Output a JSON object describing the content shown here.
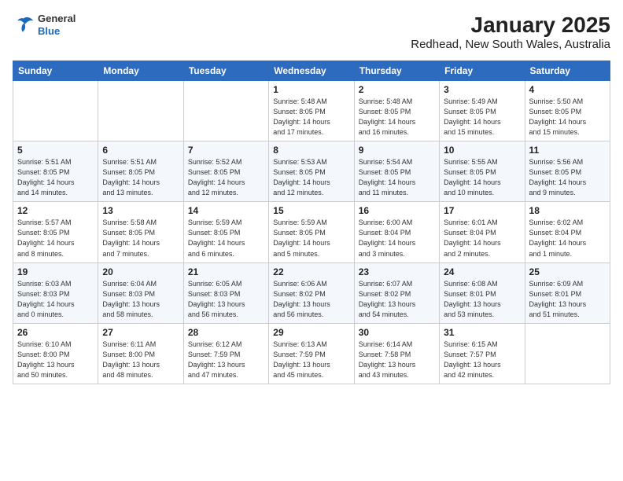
{
  "header": {
    "logo": {
      "general": "General",
      "blue": "Blue"
    },
    "title": "January 2025",
    "subtitle": "Redhead, New South Wales, Australia"
  },
  "calendar": {
    "days_of_week": [
      "Sunday",
      "Monday",
      "Tuesday",
      "Wednesday",
      "Thursday",
      "Friday",
      "Saturday"
    ],
    "weeks": [
      [
        {
          "day": "",
          "info": ""
        },
        {
          "day": "",
          "info": ""
        },
        {
          "day": "",
          "info": ""
        },
        {
          "day": "1",
          "info": "Sunrise: 5:48 AM\nSunset: 8:05 PM\nDaylight: 14 hours\nand 17 minutes."
        },
        {
          "day": "2",
          "info": "Sunrise: 5:48 AM\nSunset: 8:05 PM\nDaylight: 14 hours\nand 16 minutes."
        },
        {
          "day": "3",
          "info": "Sunrise: 5:49 AM\nSunset: 8:05 PM\nDaylight: 14 hours\nand 15 minutes."
        },
        {
          "day": "4",
          "info": "Sunrise: 5:50 AM\nSunset: 8:05 PM\nDaylight: 14 hours\nand 15 minutes."
        }
      ],
      [
        {
          "day": "5",
          "info": "Sunrise: 5:51 AM\nSunset: 8:05 PM\nDaylight: 14 hours\nand 14 minutes."
        },
        {
          "day": "6",
          "info": "Sunrise: 5:51 AM\nSunset: 8:05 PM\nDaylight: 14 hours\nand 13 minutes."
        },
        {
          "day": "7",
          "info": "Sunrise: 5:52 AM\nSunset: 8:05 PM\nDaylight: 14 hours\nand 12 minutes."
        },
        {
          "day": "8",
          "info": "Sunrise: 5:53 AM\nSunset: 8:05 PM\nDaylight: 14 hours\nand 12 minutes."
        },
        {
          "day": "9",
          "info": "Sunrise: 5:54 AM\nSunset: 8:05 PM\nDaylight: 14 hours\nand 11 minutes."
        },
        {
          "day": "10",
          "info": "Sunrise: 5:55 AM\nSunset: 8:05 PM\nDaylight: 14 hours\nand 10 minutes."
        },
        {
          "day": "11",
          "info": "Sunrise: 5:56 AM\nSunset: 8:05 PM\nDaylight: 14 hours\nand 9 minutes."
        }
      ],
      [
        {
          "day": "12",
          "info": "Sunrise: 5:57 AM\nSunset: 8:05 PM\nDaylight: 14 hours\nand 8 minutes."
        },
        {
          "day": "13",
          "info": "Sunrise: 5:58 AM\nSunset: 8:05 PM\nDaylight: 14 hours\nand 7 minutes."
        },
        {
          "day": "14",
          "info": "Sunrise: 5:59 AM\nSunset: 8:05 PM\nDaylight: 14 hours\nand 6 minutes."
        },
        {
          "day": "15",
          "info": "Sunrise: 5:59 AM\nSunset: 8:05 PM\nDaylight: 14 hours\nand 5 minutes."
        },
        {
          "day": "16",
          "info": "Sunrise: 6:00 AM\nSunset: 8:04 PM\nDaylight: 14 hours\nand 3 minutes."
        },
        {
          "day": "17",
          "info": "Sunrise: 6:01 AM\nSunset: 8:04 PM\nDaylight: 14 hours\nand 2 minutes."
        },
        {
          "day": "18",
          "info": "Sunrise: 6:02 AM\nSunset: 8:04 PM\nDaylight: 14 hours\nand 1 minute."
        }
      ],
      [
        {
          "day": "19",
          "info": "Sunrise: 6:03 AM\nSunset: 8:03 PM\nDaylight: 14 hours\nand 0 minutes."
        },
        {
          "day": "20",
          "info": "Sunrise: 6:04 AM\nSunset: 8:03 PM\nDaylight: 13 hours\nand 58 minutes."
        },
        {
          "day": "21",
          "info": "Sunrise: 6:05 AM\nSunset: 8:03 PM\nDaylight: 13 hours\nand 56 minutes."
        },
        {
          "day": "22",
          "info": "Sunrise: 6:06 AM\nSunset: 8:02 PM\nDaylight: 13 hours\nand 56 minutes."
        },
        {
          "day": "23",
          "info": "Sunrise: 6:07 AM\nSunset: 8:02 PM\nDaylight: 13 hours\nand 54 minutes."
        },
        {
          "day": "24",
          "info": "Sunrise: 6:08 AM\nSunset: 8:01 PM\nDaylight: 13 hours\nand 53 minutes."
        },
        {
          "day": "25",
          "info": "Sunrise: 6:09 AM\nSunset: 8:01 PM\nDaylight: 13 hours\nand 51 minutes."
        }
      ],
      [
        {
          "day": "26",
          "info": "Sunrise: 6:10 AM\nSunset: 8:00 PM\nDaylight: 13 hours\nand 50 minutes."
        },
        {
          "day": "27",
          "info": "Sunrise: 6:11 AM\nSunset: 8:00 PM\nDaylight: 13 hours\nand 48 minutes."
        },
        {
          "day": "28",
          "info": "Sunrise: 6:12 AM\nSunset: 7:59 PM\nDaylight: 13 hours\nand 47 minutes."
        },
        {
          "day": "29",
          "info": "Sunrise: 6:13 AM\nSunset: 7:59 PM\nDaylight: 13 hours\nand 45 minutes."
        },
        {
          "day": "30",
          "info": "Sunrise: 6:14 AM\nSunset: 7:58 PM\nDaylight: 13 hours\nand 43 minutes."
        },
        {
          "day": "31",
          "info": "Sunrise: 6:15 AM\nSunset: 7:57 PM\nDaylight: 13 hours\nand 42 minutes."
        },
        {
          "day": "",
          "info": ""
        }
      ]
    ]
  }
}
